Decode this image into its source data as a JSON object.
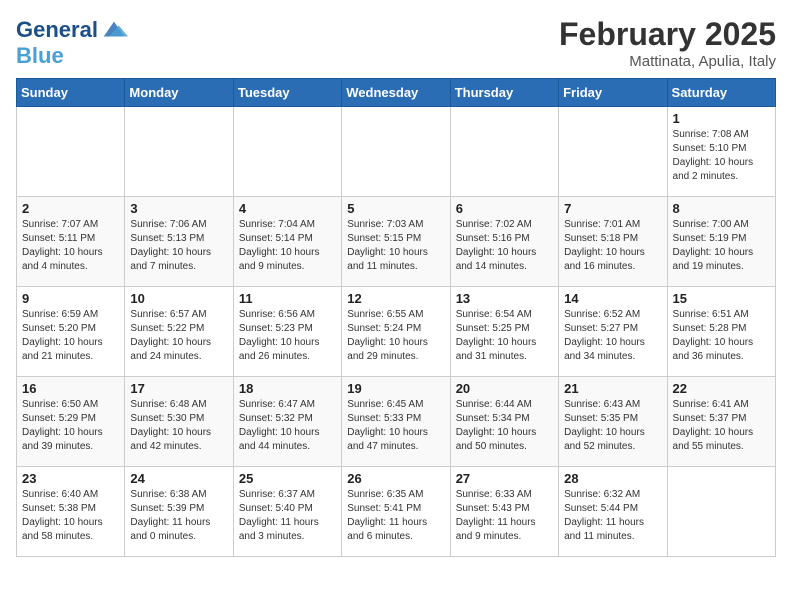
{
  "logo": {
    "line1": "General",
    "line2": "Blue"
  },
  "title": "February 2025",
  "subtitle": "Mattinata, Apulia, Italy",
  "weekdays": [
    "Sunday",
    "Monday",
    "Tuesday",
    "Wednesday",
    "Thursday",
    "Friday",
    "Saturday"
  ],
  "weeks": [
    [
      {
        "day": "",
        "info": ""
      },
      {
        "day": "",
        "info": ""
      },
      {
        "day": "",
        "info": ""
      },
      {
        "day": "",
        "info": ""
      },
      {
        "day": "",
        "info": ""
      },
      {
        "day": "",
        "info": ""
      },
      {
        "day": "1",
        "info": "Sunrise: 7:08 AM\nSunset: 5:10 PM\nDaylight: 10 hours\nand 2 minutes."
      }
    ],
    [
      {
        "day": "2",
        "info": "Sunrise: 7:07 AM\nSunset: 5:11 PM\nDaylight: 10 hours\nand 4 minutes."
      },
      {
        "day": "3",
        "info": "Sunrise: 7:06 AM\nSunset: 5:13 PM\nDaylight: 10 hours\nand 7 minutes."
      },
      {
        "day": "4",
        "info": "Sunrise: 7:04 AM\nSunset: 5:14 PM\nDaylight: 10 hours\nand 9 minutes."
      },
      {
        "day": "5",
        "info": "Sunrise: 7:03 AM\nSunset: 5:15 PM\nDaylight: 10 hours\nand 11 minutes."
      },
      {
        "day": "6",
        "info": "Sunrise: 7:02 AM\nSunset: 5:16 PM\nDaylight: 10 hours\nand 14 minutes."
      },
      {
        "day": "7",
        "info": "Sunrise: 7:01 AM\nSunset: 5:18 PM\nDaylight: 10 hours\nand 16 minutes."
      },
      {
        "day": "8",
        "info": "Sunrise: 7:00 AM\nSunset: 5:19 PM\nDaylight: 10 hours\nand 19 minutes."
      }
    ],
    [
      {
        "day": "9",
        "info": "Sunrise: 6:59 AM\nSunset: 5:20 PM\nDaylight: 10 hours\nand 21 minutes."
      },
      {
        "day": "10",
        "info": "Sunrise: 6:57 AM\nSunset: 5:22 PM\nDaylight: 10 hours\nand 24 minutes."
      },
      {
        "day": "11",
        "info": "Sunrise: 6:56 AM\nSunset: 5:23 PM\nDaylight: 10 hours\nand 26 minutes."
      },
      {
        "day": "12",
        "info": "Sunrise: 6:55 AM\nSunset: 5:24 PM\nDaylight: 10 hours\nand 29 minutes."
      },
      {
        "day": "13",
        "info": "Sunrise: 6:54 AM\nSunset: 5:25 PM\nDaylight: 10 hours\nand 31 minutes."
      },
      {
        "day": "14",
        "info": "Sunrise: 6:52 AM\nSunset: 5:27 PM\nDaylight: 10 hours\nand 34 minutes."
      },
      {
        "day": "15",
        "info": "Sunrise: 6:51 AM\nSunset: 5:28 PM\nDaylight: 10 hours\nand 36 minutes."
      }
    ],
    [
      {
        "day": "16",
        "info": "Sunrise: 6:50 AM\nSunset: 5:29 PM\nDaylight: 10 hours\nand 39 minutes."
      },
      {
        "day": "17",
        "info": "Sunrise: 6:48 AM\nSunset: 5:30 PM\nDaylight: 10 hours\nand 42 minutes."
      },
      {
        "day": "18",
        "info": "Sunrise: 6:47 AM\nSunset: 5:32 PM\nDaylight: 10 hours\nand 44 minutes."
      },
      {
        "day": "19",
        "info": "Sunrise: 6:45 AM\nSunset: 5:33 PM\nDaylight: 10 hours\nand 47 minutes."
      },
      {
        "day": "20",
        "info": "Sunrise: 6:44 AM\nSunset: 5:34 PM\nDaylight: 10 hours\nand 50 minutes."
      },
      {
        "day": "21",
        "info": "Sunrise: 6:43 AM\nSunset: 5:35 PM\nDaylight: 10 hours\nand 52 minutes."
      },
      {
        "day": "22",
        "info": "Sunrise: 6:41 AM\nSunset: 5:37 PM\nDaylight: 10 hours\nand 55 minutes."
      }
    ],
    [
      {
        "day": "23",
        "info": "Sunrise: 6:40 AM\nSunset: 5:38 PM\nDaylight: 10 hours\nand 58 minutes."
      },
      {
        "day": "24",
        "info": "Sunrise: 6:38 AM\nSunset: 5:39 PM\nDaylight: 11 hours\nand 0 minutes."
      },
      {
        "day": "25",
        "info": "Sunrise: 6:37 AM\nSunset: 5:40 PM\nDaylight: 11 hours\nand 3 minutes."
      },
      {
        "day": "26",
        "info": "Sunrise: 6:35 AM\nSunset: 5:41 PM\nDaylight: 11 hours\nand 6 minutes."
      },
      {
        "day": "27",
        "info": "Sunrise: 6:33 AM\nSunset: 5:43 PM\nDaylight: 11 hours\nand 9 minutes."
      },
      {
        "day": "28",
        "info": "Sunrise: 6:32 AM\nSunset: 5:44 PM\nDaylight: 11 hours\nand 11 minutes."
      },
      {
        "day": "",
        "info": ""
      }
    ]
  ]
}
